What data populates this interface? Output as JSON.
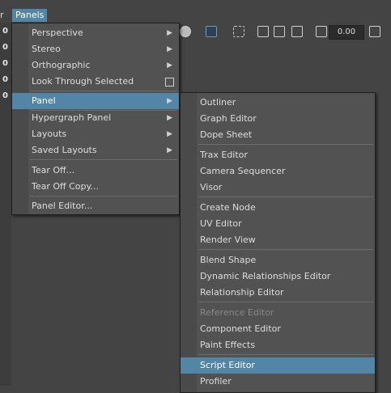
{
  "menubar": {
    "prev_label": "r",
    "active_label": "Panels"
  },
  "toolbar": {
    "value_field": "0.00"
  },
  "left_values": [
    "0",
    "0",
    "0",
    "0",
    "0"
  ],
  "panels_menu": {
    "items": [
      {
        "label": "Perspective",
        "submenu": true
      },
      {
        "label": "Stereo",
        "submenu": true
      },
      {
        "label": "Orthographic",
        "submenu": true
      },
      {
        "label": "Look Through Selected",
        "checkbox": true
      },
      {
        "label": "Panel",
        "submenu": true,
        "active": true
      },
      {
        "label": "Hypergraph Panel",
        "submenu": true
      },
      {
        "label": "Layouts",
        "submenu": true
      },
      {
        "label": "Saved Layouts",
        "submenu": true
      },
      {
        "label": "Tear Off..."
      },
      {
        "label": "Tear Off Copy..."
      },
      {
        "label": "Panel Editor..."
      }
    ]
  },
  "panel_submenu": {
    "items": [
      {
        "label": "Outliner"
      },
      {
        "label": "Graph Editor"
      },
      {
        "label": "Dope Sheet"
      },
      {
        "label": "Trax Editor"
      },
      {
        "label": "Camera Sequencer"
      },
      {
        "label": "Visor"
      },
      {
        "label": "Create Node"
      },
      {
        "label": "UV Editor"
      },
      {
        "label": "Render View"
      },
      {
        "label": "Blend Shape"
      },
      {
        "label": "Dynamic Relationships Editor"
      },
      {
        "label": "Relationship Editor"
      },
      {
        "label": "Reference Editor",
        "disabled": true
      },
      {
        "label": "Component Editor"
      },
      {
        "label": "Paint Effects"
      },
      {
        "label": "Script Editor",
        "active": true
      },
      {
        "label": "Profiler"
      }
    ]
  }
}
